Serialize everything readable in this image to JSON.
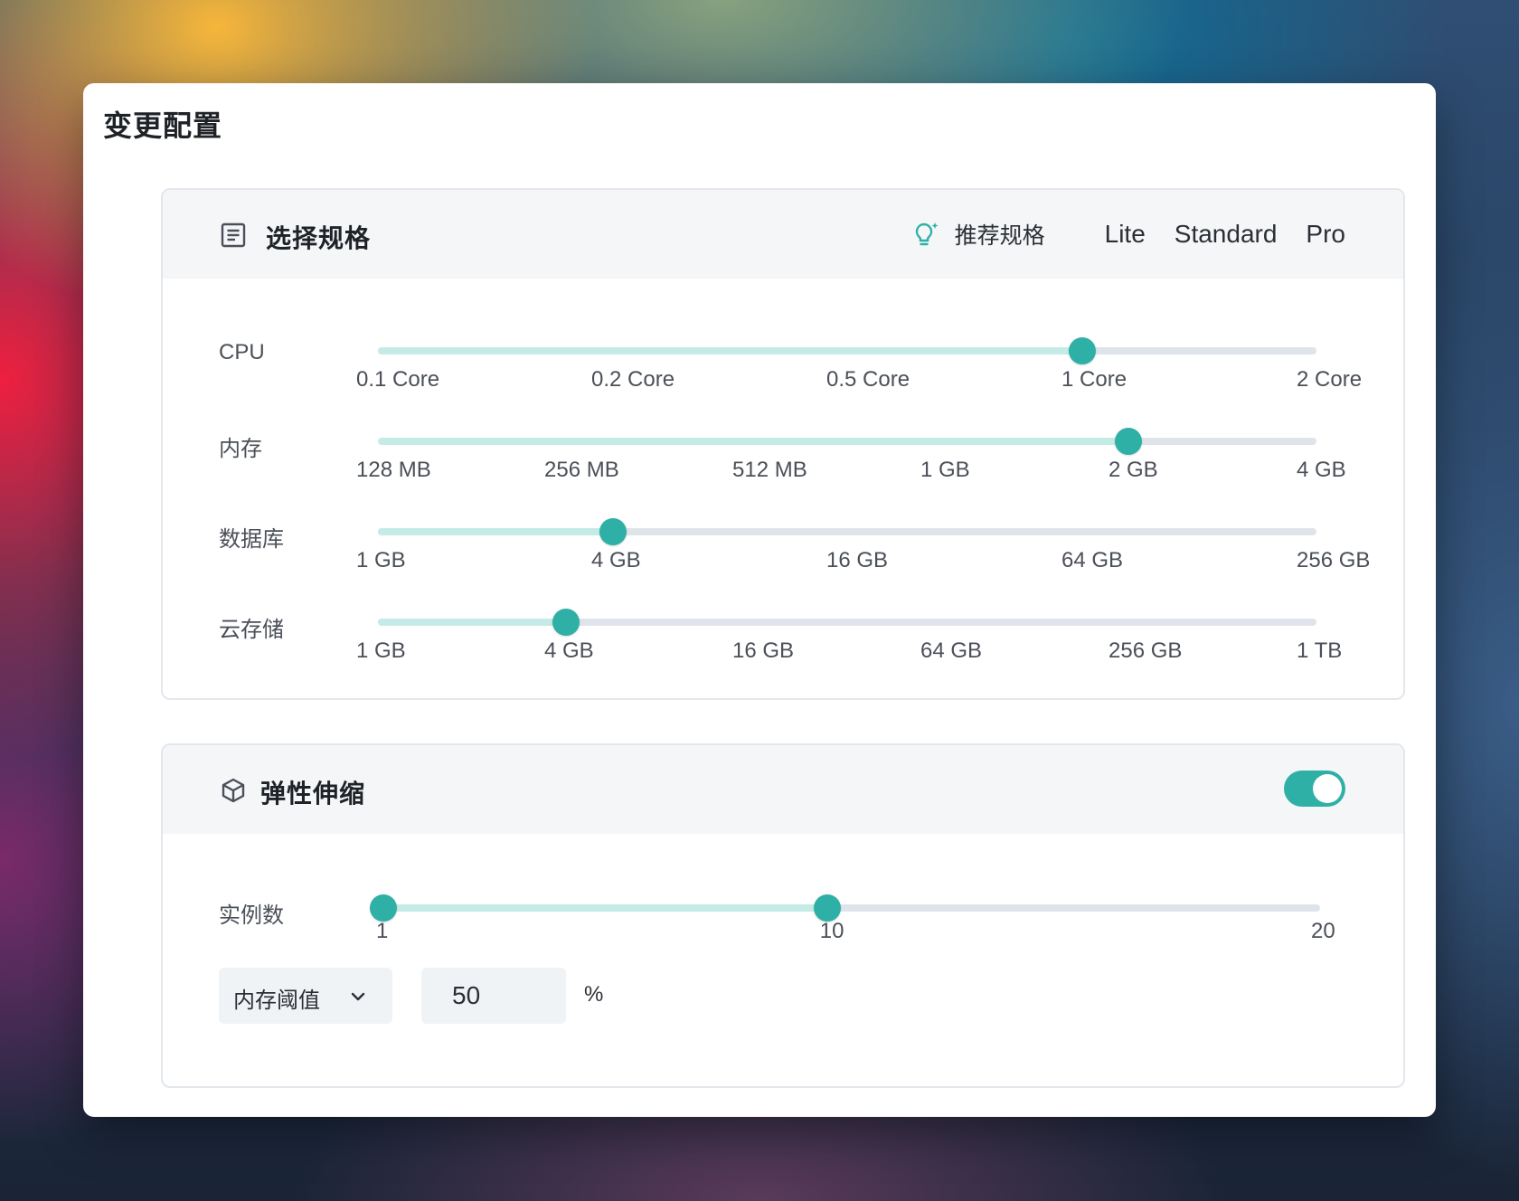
{
  "window": {
    "title": "变更配置"
  },
  "spec": {
    "title": "选择规格",
    "icon": "document-list-icon",
    "recommend": {
      "icon": "lightbulb-sparkle-icon",
      "label": "推荐规格"
    },
    "presets": [
      "Lite",
      "Standard",
      "Pro"
    ],
    "rows": [
      {
        "label": "CPU",
        "ticks": [
          "0.1 Core",
          "0.2 Core",
          "0.5 Core",
          "1 Core",
          "2 Core"
        ],
        "selected": "1 Core",
        "selected_index": 3
      },
      {
        "label": "内存",
        "ticks": [
          "128 MB",
          "256 MB",
          "512 MB",
          "1 GB",
          "2 GB",
          "4 GB"
        ],
        "selected": "2 GB",
        "selected_index": 4
      },
      {
        "label": "数据库",
        "ticks": [
          "1 GB",
          "4 GB",
          "16 GB",
          "64 GB",
          "256 GB"
        ],
        "selected": "4 GB",
        "selected_index": 1
      },
      {
        "label": "云存储",
        "ticks": [
          "1 GB",
          "4 GB",
          "16 GB",
          "64 GB",
          "256 GB",
          "1 TB"
        ],
        "selected": "4 GB",
        "selected_index": 1
      }
    ]
  },
  "scaling": {
    "title": "弹性伸缩",
    "icon": "cube-icon",
    "enabled": true,
    "instances": {
      "label": "实例数",
      "min": 1,
      "max": 20,
      "ticks": [
        "1",
        "10",
        "20"
      ],
      "range": [
        1,
        10
      ]
    },
    "metric": {
      "selected": "内存阈值",
      "icon": "chevron-down-icon"
    },
    "threshold": {
      "value": "50",
      "unit": "%"
    }
  },
  "colors": {
    "accent": "#2fb0a6",
    "accent_light": "#c4ebe5",
    "track": "#dfe4ea"
  }
}
